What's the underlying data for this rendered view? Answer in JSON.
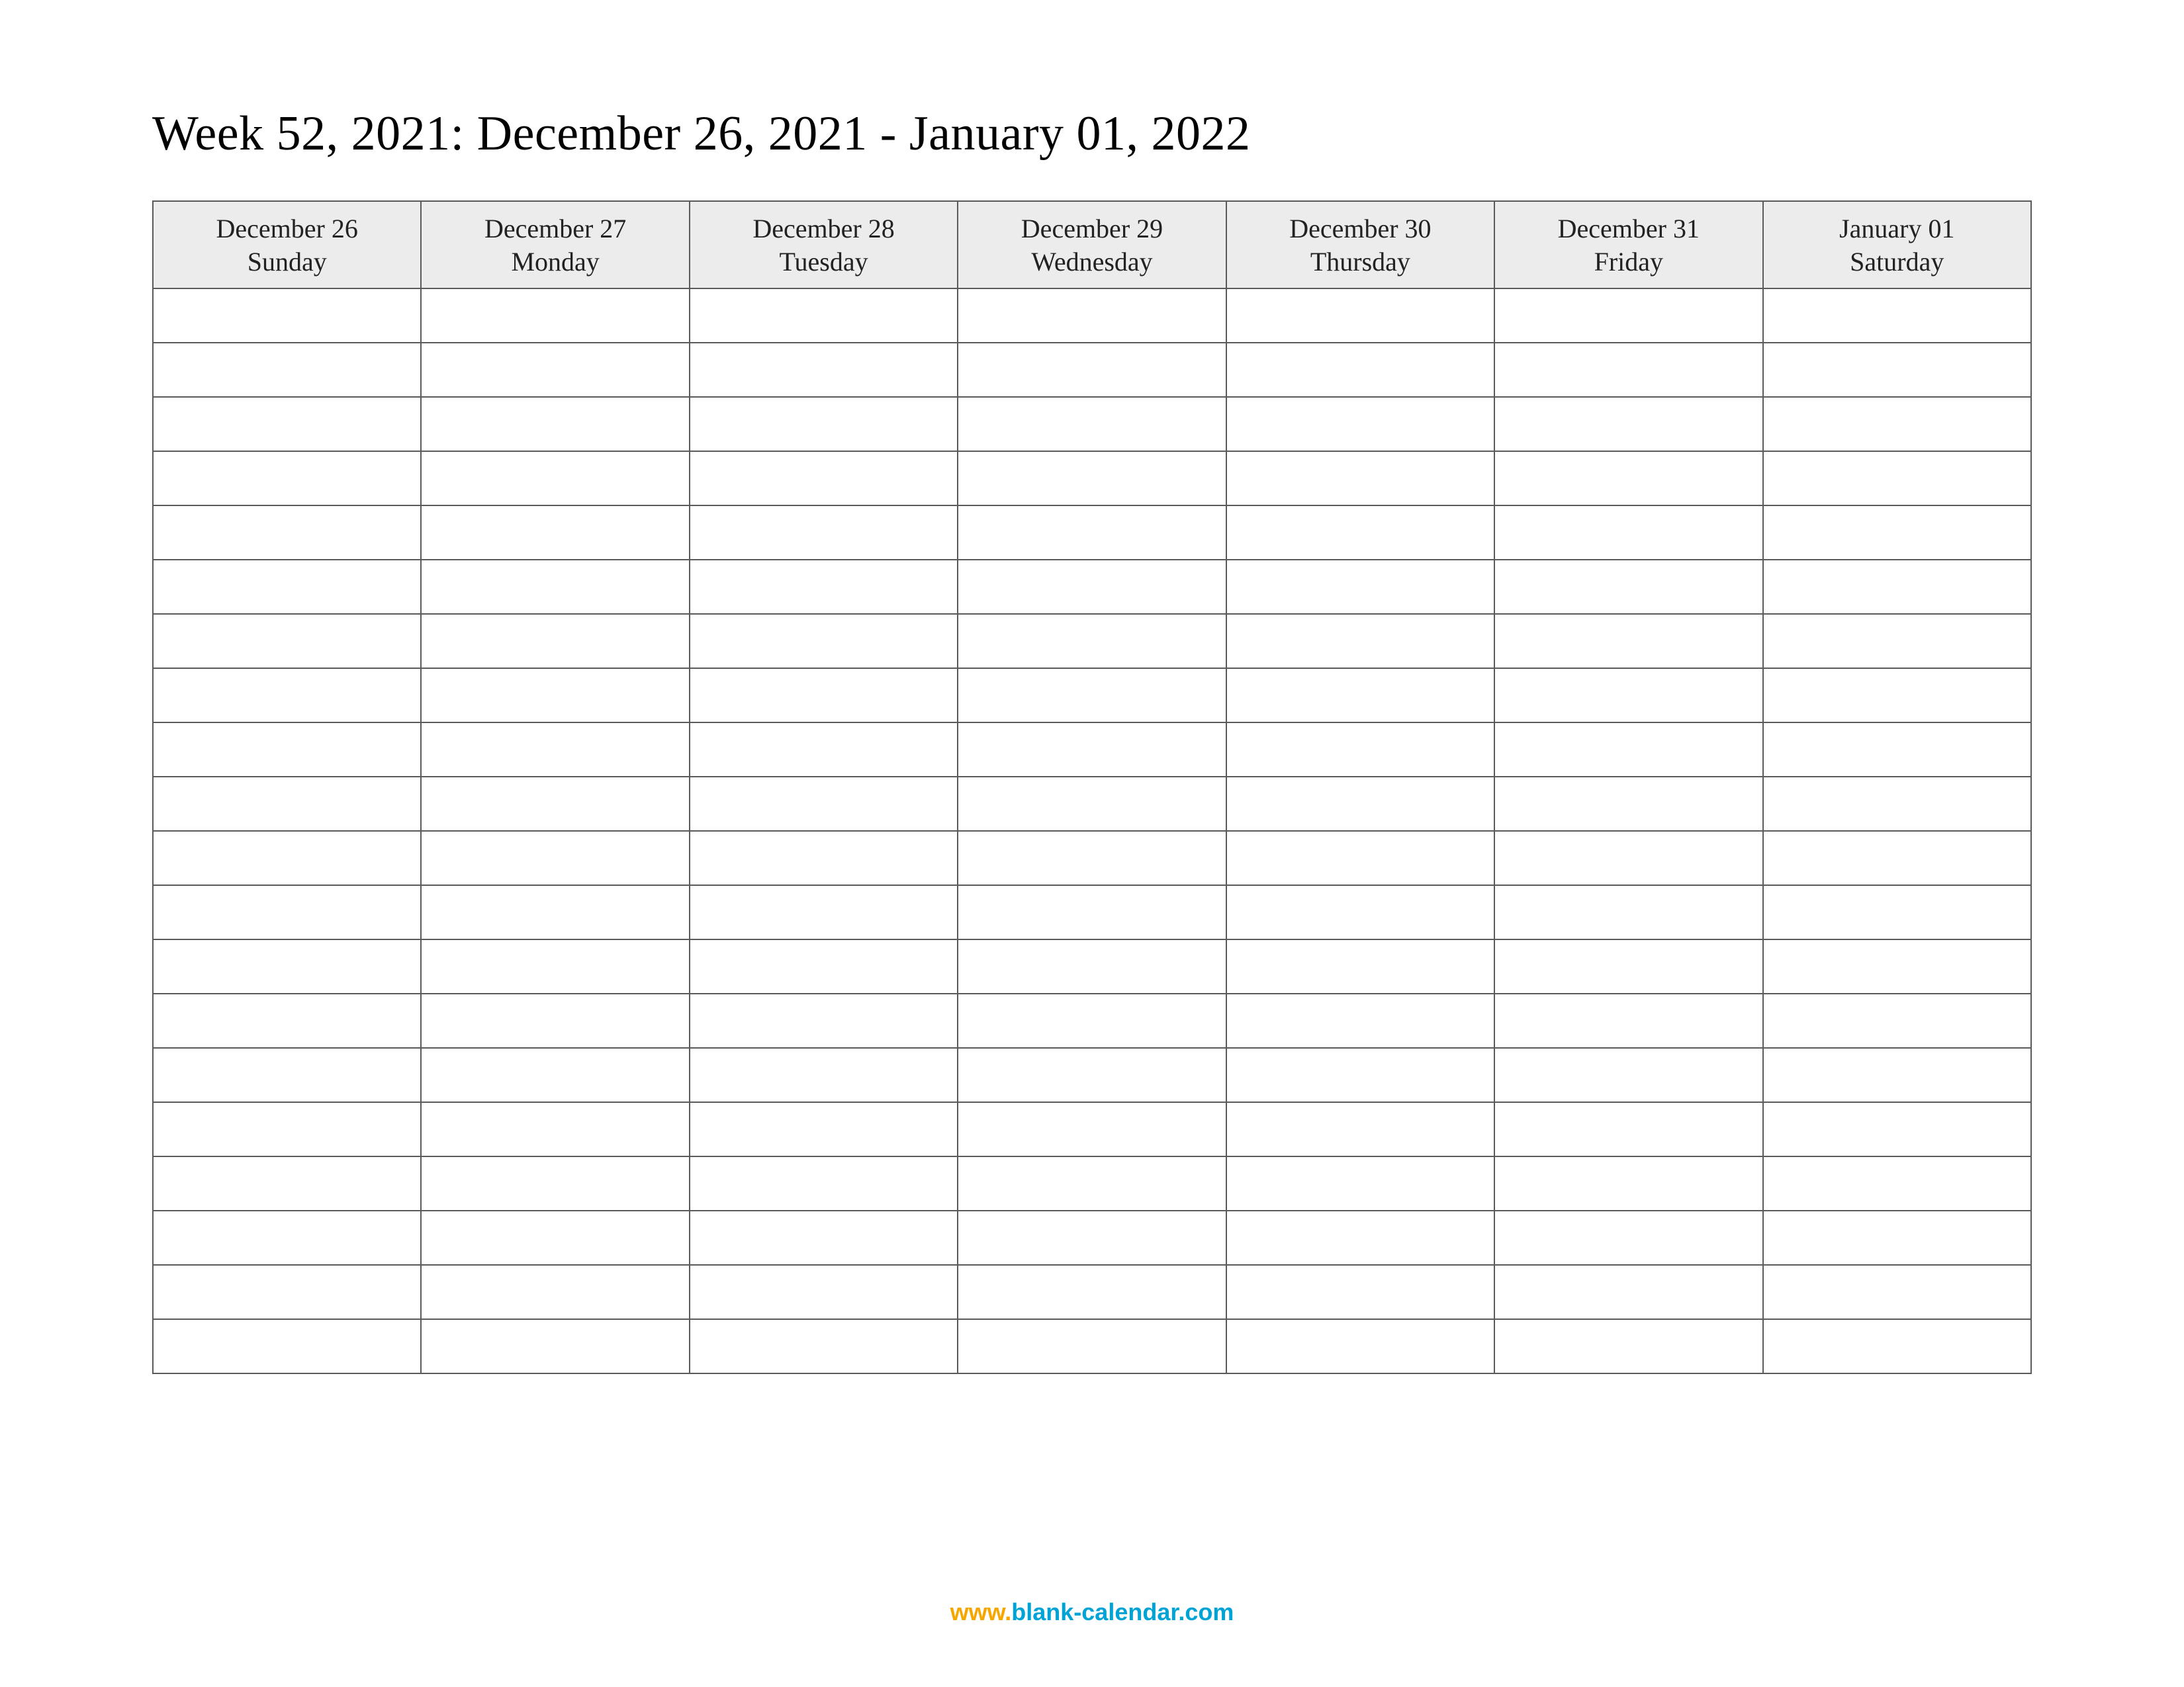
{
  "title": "Week 52, 2021: December 26, 2021 - January 01, 2022",
  "days": [
    {
      "date": "December 26",
      "dow": "Sunday"
    },
    {
      "date": "December 27",
      "dow": "Monday"
    },
    {
      "date": "December 28",
      "dow": "Tuesday"
    },
    {
      "date": "December 29",
      "dow": "Wednesday"
    },
    {
      "date": "December 30",
      "dow": "Thursday"
    },
    {
      "date": "December 31",
      "dow": "Friday"
    },
    {
      "date": "January 01",
      "dow": "Saturday"
    }
  ],
  "row_count": 20,
  "footer": {
    "prefix": "www.",
    "domain": "blank-calendar.com"
  }
}
